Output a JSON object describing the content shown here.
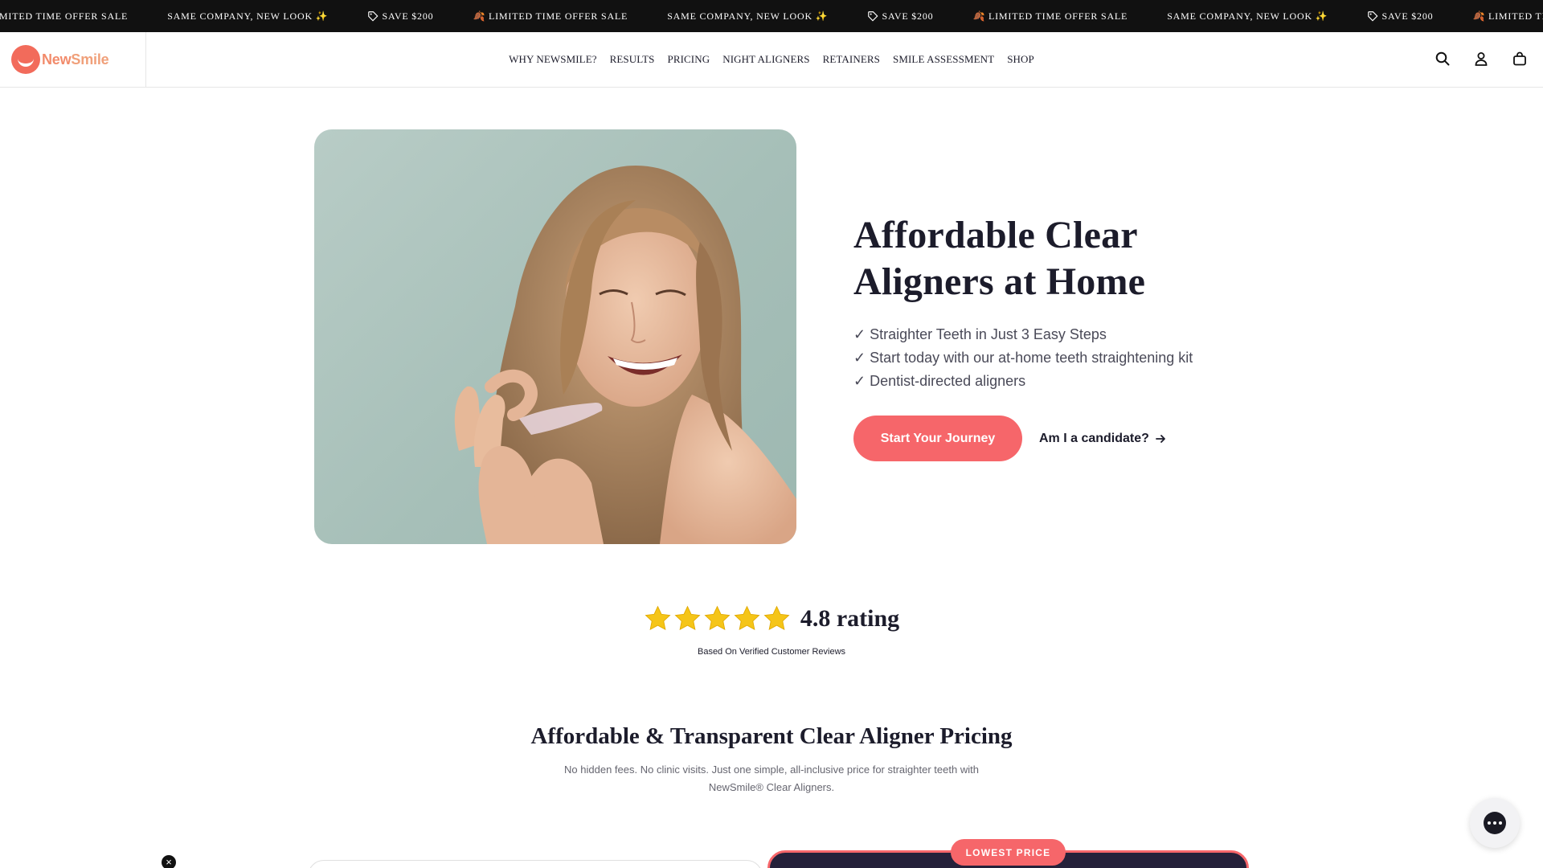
{
  "announcement": {
    "items": [
      {
        "icon": "leaf-icon",
        "text": "LIMITED TIME OFFER SALE"
      },
      {
        "icon": "",
        "text": "SAME COMPANY, NEW LOOK ✨"
      },
      {
        "icon": "tag-icon",
        "text": "SAVE $200"
      },
      {
        "icon": "leaf-icon",
        "text": "🍂 LIMITED TIME OFFER SALE"
      },
      {
        "icon": "",
        "text": "SAME COMPANY, NEW LOOK ✨"
      },
      {
        "icon": "tag-icon",
        "text": "SAVE $200"
      },
      {
        "icon": "leaf-icon",
        "text": "🍂 LIMITED TIME OFFER SALE"
      },
      {
        "icon": "",
        "text": "SAME COMPANY, NEW LOOK ✨"
      },
      {
        "icon": "tag-icon",
        "text": "SAVE $200"
      },
      {
        "icon": "leaf-icon",
        "text": "🍂 LIMITED TIME OFFER SALE"
      }
    ]
  },
  "header": {
    "logo": {
      "part1": "New",
      "part2": "Smile"
    },
    "nav": [
      "WHY NEWSMILE?",
      "RESULTS",
      "PRICING",
      "NIGHT ALIGNERS",
      "RETAINERS",
      "SMILE ASSESSMENT",
      "SHOP"
    ],
    "icons": [
      "search-icon",
      "account-icon",
      "cart-icon"
    ]
  },
  "hero": {
    "title_line1": "Affordable Clear",
    "title_line2": "Aligners at Home",
    "bullets": [
      "✓ Straighter Teeth in Just 3 Easy Steps",
      "✓ Start today with our at-home teeth straightening kit",
      "✓ Dentist-directed aligners"
    ],
    "cta_primary": "Start Your Journey",
    "cta_secondary": "Am I a candidate?"
  },
  "rating": {
    "value": 4.8,
    "stars": 5,
    "text": "4.8 rating",
    "subtext": "Based On Verified Customer Reviews"
  },
  "pricing": {
    "title": "Affordable & Transparent Clear Aligner Pricing",
    "subtitle": "No hidden fees. No clinic visits. Just one simple, all-inclusive price for straighter teeth with NewSmile® Clear Aligners.",
    "badge": "LOWEST PRICE"
  },
  "colors": {
    "accent": "#f6666a",
    "dark": "#1c1c2b",
    "announce_bg": "#111111",
    "card_dark": "#25213a",
    "star": "#f5c518"
  }
}
